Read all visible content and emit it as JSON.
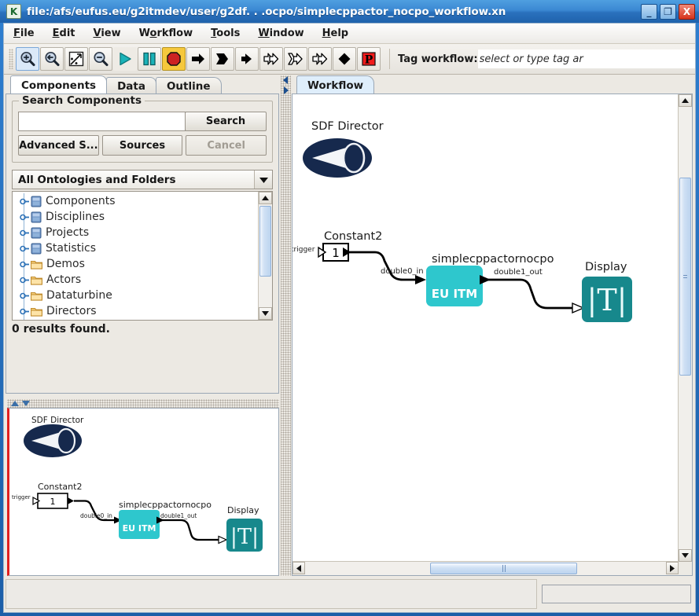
{
  "window": {
    "icon": "kepler-k-icon",
    "title": "file:/afs/eufus.eu/g2itmdev/user/g2df. . .ocpo/simplecppactor_nocpo_workflow.xn",
    "minimize": "_",
    "maximize": "❐",
    "close": "X"
  },
  "menubar": {
    "items": [
      {
        "label": "File",
        "mnemonic": "F"
      },
      {
        "label": "Edit",
        "mnemonic": "E"
      },
      {
        "label": "View",
        "mnemonic": "V"
      },
      {
        "label": "Workflow",
        "mnemonic": "o"
      },
      {
        "label": "Tools",
        "mnemonic": "T"
      },
      {
        "label": "Window",
        "mnemonic": "W"
      },
      {
        "label": "Help",
        "mnemonic": "H"
      }
    ]
  },
  "toolbar": {
    "buttons": [
      {
        "name": "zoom-in-icon",
        "title": "Zoom In"
      },
      {
        "name": "zoom-reset-icon",
        "title": "Zoom Reset"
      },
      {
        "name": "zoom-fit-icon",
        "title": "Zoom Fit"
      },
      {
        "name": "zoom-out-icon",
        "title": "Zoom Out"
      },
      {
        "name": "run-icon",
        "title": "Run"
      },
      {
        "name": "pause-icon",
        "title": "Pause"
      },
      {
        "name": "stop-icon",
        "title": "Stop"
      },
      {
        "name": "step-icon",
        "title": "Step"
      },
      {
        "name": "run-to-icon",
        "title": "Run To"
      },
      {
        "name": "step-into-icon",
        "title": "Step Into"
      },
      {
        "name": "fast-forward-icon",
        "title": "Fast Forward"
      },
      {
        "name": "skip-icon",
        "title": "Skip"
      },
      {
        "name": "advance-icon",
        "title": "Advance"
      },
      {
        "name": "diamond-icon",
        "title": "Breakpoint"
      },
      {
        "name": "provenance-icon",
        "title": "Provenance"
      }
    ],
    "tag_label": "Tag workflow:",
    "tag_placeholder": "select or type tag ar",
    "tag_value": ""
  },
  "left_panel": {
    "tabs": [
      {
        "label": "Components",
        "active": true
      },
      {
        "label": "Data",
        "active": false
      },
      {
        "label": "Outline",
        "active": false
      }
    ],
    "search_group": {
      "title": "Search Components",
      "input_value": "",
      "search_button": "Search",
      "advanced_button": "Advanced S...",
      "sources_button": "Sources",
      "cancel_button": "Cancel"
    },
    "ontology_combo": {
      "selected": "All Ontologies and Folders"
    },
    "tree_items": [
      {
        "label": "Components",
        "icon": "ontology-icon"
      },
      {
        "label": "Disciplines",
        "icon": "ontology-icon"
      },
      {
        "label": "Projects",
        "icon": "ontology-icon"
      },
      {
        "label": "Statistics",
        "icon": "ontology-icon"
      },
      {
        "label": "Demos",
        "icon": "folder-icon"
      },
      {
        "label": "Actors",
        "icon": "folder-icon"
      },
      {
        "label": "Dataturbine",
        "icon": "folder-icon"
      },
      {
        "label": "Directors",
        "icon": "folder-icon"
      }
    ],
    "results_text": "0 results found."
  },
  "right_panel": {
    "tabs": [
      {
        "label": "Workflow",
        "active": true
      }
    ]
  },
  "graph": {
    "director": {
      "label": "SDF Director",
      "color": "#16294d"
    },
    "nodes": [
      {
        "name": "Constant2",
        "label": "Constant2",
        "value": "1",
        "port_in": "trigger"
      },
      {
        "name": "simplecppactornocpo",
        "label": "simplecppactornocpo",
        "body_text": "EU ITM",
        "color": "#2ec7cd",
        "port_in": "double0_in",
        "port_out": "double1_out"
      },
      {
        "name": "Display",
        "label": "Display",
        "body_text": "T",
        "color": "#17888c"
      }
    ],
    "links": [
      {
        "from": "Constant2",
        "to": "simplecppactornocpo",
        "label": "double0_in"
      },
      {
        "from": "simplecppactornocpo",
        "to": "Display",
        "label": "double1_out"
      }
    ]
  },
  "statusbar": {
    "message": "",
    "secondary": ""
  },
  "colors": {
    "accent": "#2a71bd",
    "teal": "#2ec7cd",
    "teal_dark": "#17888c",
    "navy": "#16294d",
    "stop_red": "#cc2222",
    "highlight_yellow": "#f6c83c"
  }
}
